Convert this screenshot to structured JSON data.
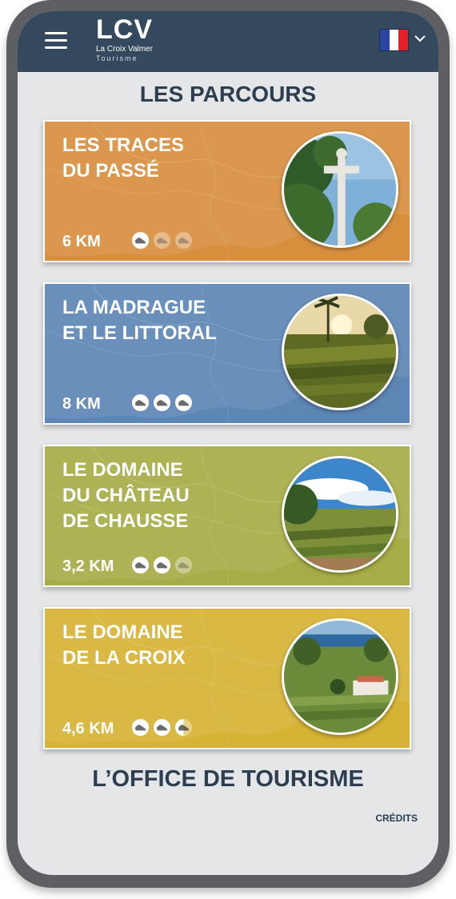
{
  "header": {
    "logo_mark": "LCV",
    "logo_title": "La Croix Valmer",
    "logo_subtitle": "Tourisme",
    "menu_icon": "hamburger-menu-icon",
    "language_flag": "flag-france-icon",
    "language_dropdown_icon": "chevron-down-icon",
    "colors": {
      "header_bg": "#34495e",
      "page_bg": "#e5e6e8"
    }
  },
  "main": {
    "title": "LES PARCOURS",
    "routes": [
      {
        "title_lines": [
          "LES TRACES",
          "DU PASSÉ"
        ],
        "distance": "6 KM",
        "difficulty": 1,
        "difficulty_max": 3,
        "color": "#d78f3e",
        "photo": "stone-cross-among-pines"
      },
      {
        "title_lines": [
          "LA MADRAGUE",
          "ET LE LITTORAL"
        ],
        "distance": "8 KM",
        "difficulty": 3,
        "difficulty_max": 3,
        "color": "#5d86b5",
        "photo": "vineyard-at-sunset-with-palm"
      },
      {
        "title_lines": [
          "LE DOMAINE",
          "DU CHÂTEAU",
          "DE CHAUSSE"
        ],
        "distance": "3,2 KM",
        "difficulty": 2,
        "difficulty_max": 3,
        "color": "#a7ad46",
        "photo": "vineyard-under-blue-sky"
      },
      {
        "title_lines": [
          "LE DOMAINE",
          "DE LA CROIX"
        ],
        "distance": "4,6 KM",
        "difficulty": 2.5,
        "difficulty_max": 3,
        "color": "#d6b235",
        "photo": "estate-with-sea-view"
      }
    ],
    "difficulty_icon": "walking-shoe-icon",
    "office_title": "L’OFFICE DE TOURISME",
    "credits": "CRÉDITS"
  }
}
